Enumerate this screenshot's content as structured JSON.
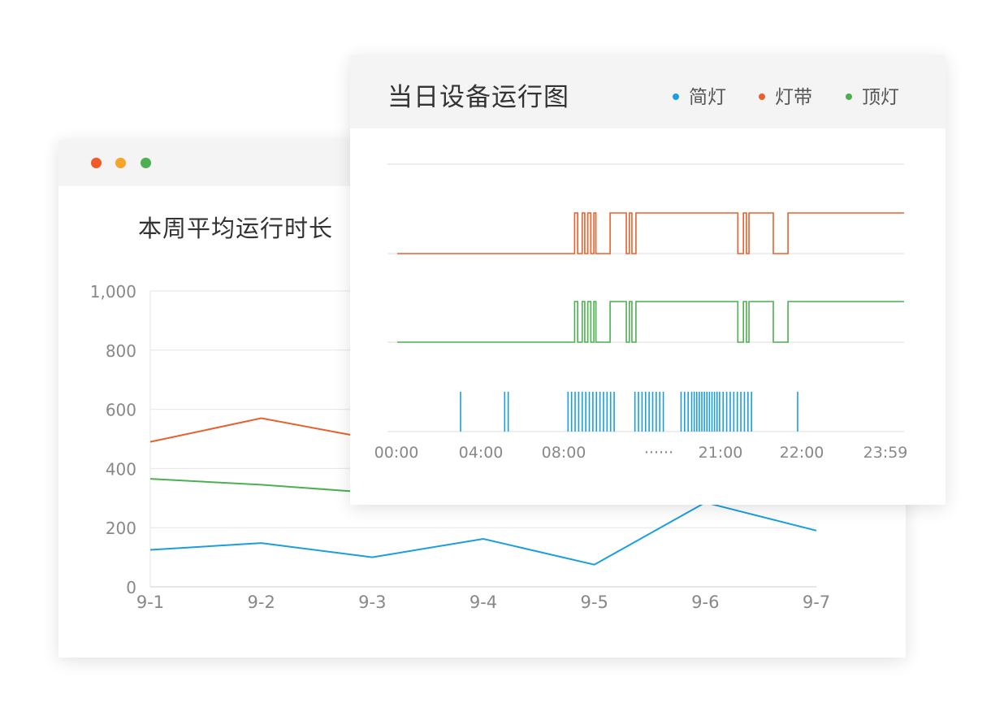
{
  "colors": {
    "blue": "#1a9ee0",
    "orange": "#e8602c",
    "green": "#4caf50",
    "grid": "#e6e6e6",
    "axis": "#cccccc",
    "tick": "#888888"
  },
  "window_dots": [
    {
      "name": "close",
      "color": "#f05a28"
    },
    {
      "name": "minimize",
      "color": "#f7a42b"
    },
    {
      "name": "maximize",
      "color": "#4caf50"
    }
  ],
  "weekly_panel": {
    "title": "本周平均运行时长"
  },
  "daily_panel": {
    "title": "当日设备运行图",
    "legend": [
      {
        "label": "简灯",
        "color": "#1a9ee0"
      },
      {
        "label": "灯带",
        "color": "#e8602c"
      },
      {
        "label": "顶灯",
        "color": "#4caf50"
      }
    ]
  },
  "chart_data": [
    {
      "type": "line",
      "title": "本周平均运行时长",
      "categories": [
        "9-1",
        "9-2",
        "9-3",
        "9-4",
        "9-5",
        "9-6",
        "9-7"
      ],
      "yticks": [
        "0",
        "200",
        "400",
        "600",
        "800",
        "1,000"
      ],
      "ylim": [
        0,
        1000
      ],
      "grid": true,
      "series": [
        {
          "color": "#e8602c",
          "values": [
            490,
            570,
            500,
            null,
            null,
            null,
            null
          ]
        },
        {
          "color": "#4caf50",
          "values": [
            365,
            345,
            318,
            null,
            null,
            null,
            null
          ]
        },
        {
          "color": "#1a9ee0",
          "values": [
            125,
            148,
            100,
            162,
            75,
            285,
            190
          ]
        }
      ]
    },
    {
      "type": "line",
      "title": "当日设备运行图",
      "xticks": [
        "00:00",
        "04:00",
        "08:00",
        "······",
        "21:00",
        "22:00",
        "23:59"
      ],
      "series": [
        {
          "name": "灯带",
          "color": "#e8602c",
          "states": [
            [
              0,
              0
            ],
            [
              0.35,
              1
            ],
            [
              0.356,
              0
            ],
            [
              0.365,
              1
            ],
            [
              0.37,
              0
            ],
            [
              0.376,
              1
            ],
            [
              0.382,
              0
            ],
            [
              0.388,
              1
            ],
            [
              0.392,
              0
            ],
            [
              0.42,
              1
            ],
            [
              0.452,
              0
            ],
            [
              0.458,
              1
            ],
            [
              0.463,
              0
            ],
            [
              0.471,
              1
            ],
            [
              0.672,
              0
            ],
            [
              0.683,
              1
            ],
            [
              0.689,
              0
            ],
            [
              0.694,
              1
            ],
            [
              0.742,
              0
            ],
            [
              0.771,
              1
            ],
            [
              1,
              1
            ]
          ]
        },
        {
          "name": "顶灯",
          "color": "#4caf50",
          "states": [
            [
              0,
              0
            ],
            [
              0.35,
              1
            ],
            [
              0.356,
              0
            ],
            [
              0.365,
              1
            ],
            [
              0.37,
              0
            ],
            [
              0.376,
              1
            ],
            [
              0.382,
              0
            ],
            [
              0.388,
              1
            ],
            [
              0.392,
              0
            ],
            [
              0.42,
              1
            ],
            [
              0.452,
              0
            ],
            [
              0.458,
              1
            ],
            [
              0.463,
              0
            ],
            [
              0.471,
              1
            ],
            [
              0.672,
              0
            ],
            [
              0.683,
              1
            ],
            [
              0.689,
              0
            ],
            [
              0.694,
              1
            ],
            [
              0.742,
              0
            ],
            [
              0.771,
              1
            ],
            [
              1,
              1
            ]
          ]
        },
        {
          "name": "简灯",
          "color": "#1a9ee0",
          "events": [
            0.125,
            0.212,
            0.219,
            0.337,
            0.344,
            0.351,
            0.358,
            0.365,
            0.372,
            0.379,
            0.386,
            0.393,
            0.4,
            0.407,
            0.414,
            0.421,
            0.428,
            0.469,
            0.476,
            0.483,
            0.49,
            0.497,
            0.504,
            0.511,
            0.518,
            0.525,
            0.56,
            0.567,
            0.574,
            0.581,
            0.586,
            0.591,
            0.596,
            0.601,
            0.606,
            0.611,
            0.616,
            0.621,
            0.626,
            0.631,
            0.636,
            0.643,
            0.65,
            0.657,
            0.664,
            0.671,
            0.678,
            0.685,
            0.692,
            0.699,
            0.79
          ]
        }
      ]
    }
  ]
}
